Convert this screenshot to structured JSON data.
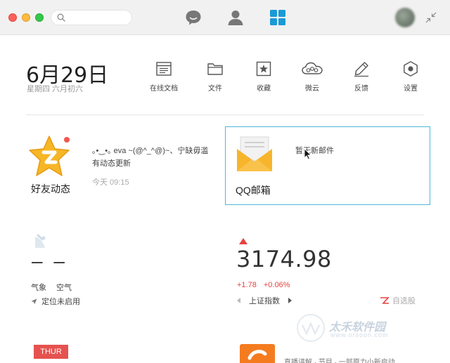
{
  "titlebar": {
    "search_placeholder": "",
    "nav": [
      "chat",
      "contacts",
      "apps"
    ]
  },
  "header": {
    "date": "6月29日",
    "subdate": "星期四  六月初六"
  },
  "tools": [
    {
      "label": "在线文档",
      "icon": "document-icon"
    },
    {
      "label": "文件",
      "icon": "folder-icon"
    },
    {
      "label": "收藏",
      "icon": "star-bookmark-icon"
    },
    {
      "label": "微云",
      "icon": "cloud-icon"
    },
    {
      "label": "反馈",
      "icon": "pen-icon"
    },
    {
      "label": "设置",
      "icon": "settings-icon"
    }
  ],
  "feed": {
    "title": "好友动态",
    "text": "｡•‿•｡ eva ~(@^_^@)~、宁缺毋滥有动态更新",
    "time": "今天 09:15"
  },
  "mail": {
    "title": "QQ邮箱",
    "status": "暂无新邮件"
  },
  "weather": {
    "temp": "– –",
    "label_weather": "气象",
    "label_air": "空气",
    "location": "定位未启用"
  },
  "stock": {
    "value": "3174.98",
    "change": "+1.78",
    "change_pct": "+0.06%",
    "name": "上证指数",
    "watchlist": "自选股",
    "color_up": "#e64340"
  },
  "bottom": {
    "day_badge": "THUR",
    "news_text": "直播讲解 · 节目 · 一部原力小新启动"
  },
  "watermark": {
    "text": "太禾软件园",
    "url": "www.orsoon.com"
  },
  "colors": {
    "accent": "#1b9ad6",
    "card_border": "#4fb8d8",
    "star": "#f6b626"
  }
}
